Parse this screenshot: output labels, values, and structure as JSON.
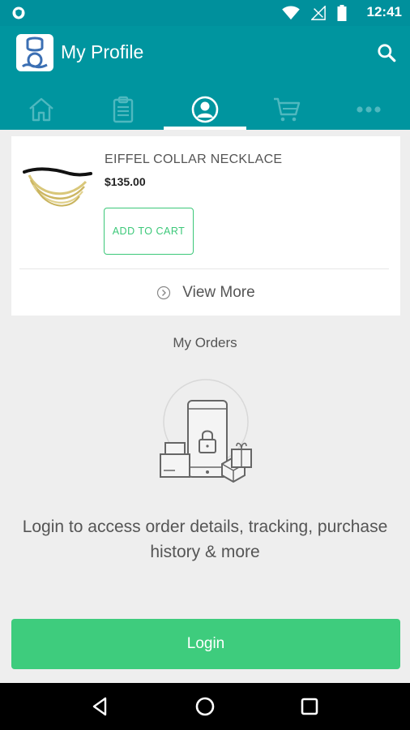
{
  "status_bar": {
    "time": "12:41",
    "icons": [
      "shield-icon",
      "wifi-icon",
      "signal-icon",
      "battery-icon"
    ]
  },
  "app_bar": {
    "title": "My Profile",
    "tabs": [
      {
        "name": "home-icon",
        "active": false
      },
      {
        "name": "clipboard-icon",
        "active": false
      },
      {
        "name": "profile-icon",
        "active": true
      },
      {
        "name": "cart-icon",
        "active": false
      },
      {
        "name": "more-icon",
        "active": false
      }
    ]
  },
  "product": {
    "name": "EIFFEL COLLAR NECKLACE",
    "price": "$135.00",
    "add_to_cart_label": "ADD TO CART"
  },
  "view_more_label": "View More",
  "orders": {
    "title": "My Orders",
    "message": "Login to access order details, tracking, purchase history & more"
  },
  "login_label": "Login",
  "colors": {
    "primary": "#00959f",
    "accent": "#3ecc7d",
    "background": "#eeeeee"
  }
}
